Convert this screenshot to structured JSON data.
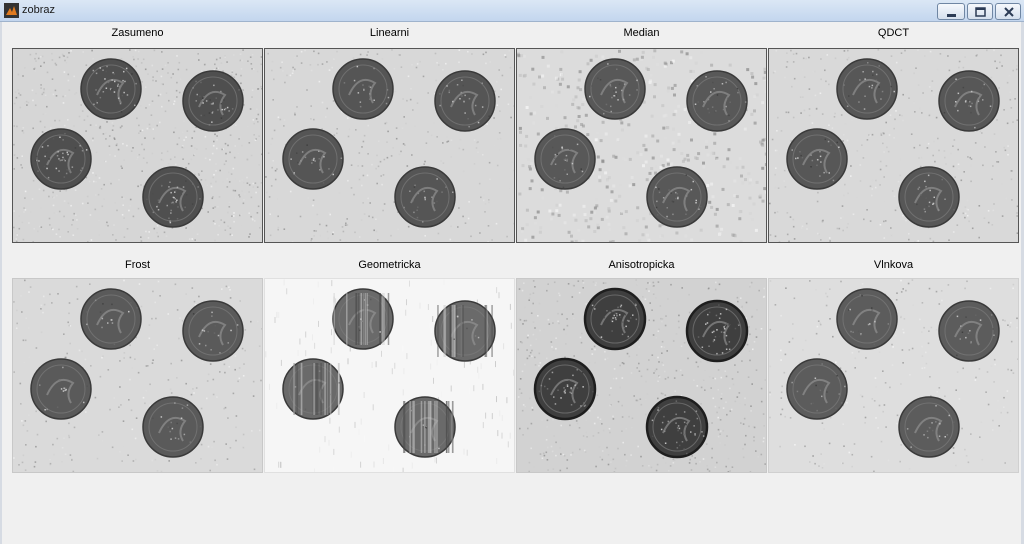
{
  "window": {
    "title": "zobraz",
    "controls": {
      "minimize": "minimize-icon",
      "maximize": "maximize-icon",
      "close": "close-icon"
    }
  },
  "panels": [
    {
      "title": "Zasumeno",
      "bg": "#d6d6d6",
      "coin": "#4f4f4f",
      "noise": 0.55,
      "style": "noisy"
    },
    {
      "title": "Linearni",
      "bg": "#d8d8d8",
      "coin": "#555555",
      "noise": 0.3,
      "style": "smooth"
    },
    {
      "title": "Median",
      "bg": "#dcdcdc",
      "coin": "#585858",
      "noise": 0.35,
      "style": "blotchy"
    },
    {
      "title": "QDCT",
      "bg": "#d9d9d9",
      "coin": "#575757",
      "noise": 0.3,
      "style": "smooth"
    },
    {
      "title": "Frost",
      "bg": "#dadada",
      "coin": "#5a5a5a",
      "noise": 0.22,
      "style": "smooth"
    },
    {
      "title": "Geometricka",
      "bg": "#f6f6f6",
      "coin": "#6a6a6a",
      "noise": 0.1,
      "style": "streaks"
    },
    {
      "title": "Anisotropicka",
      "bg": "#d2d2d2",
      "coin": "#3f3f3f",
      "noise": 0.45,
      "style": "sharp"
    },
    {
      "title": "Vlnkova",
      "bg": "#dedede",
      "coin": "#5c5c5c",
      "noise": 0.22,
      "style": "smooth"
    }
  ]
}
